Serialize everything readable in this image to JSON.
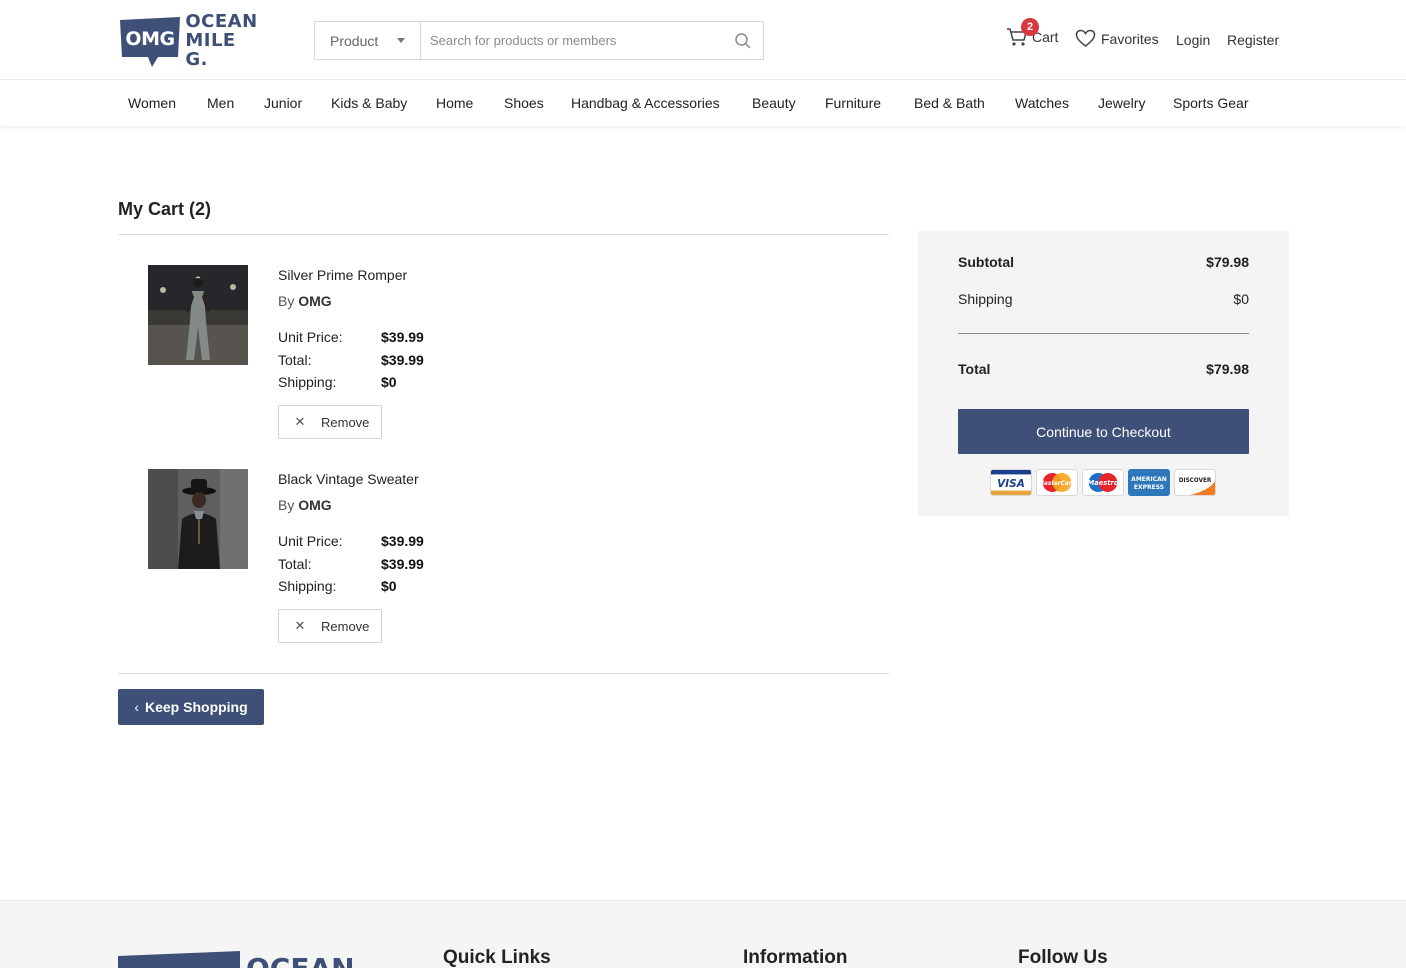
{
  "brand": {
    "badge": "OMG",
    "line1": "OCEAN",
    "line2": "MILE G."
  },
  "search": {
    "category": "Product",
    "placeholder": "Search for products or members"
  },
  "header": {
    "cart_count": "2",
    "cart_label": "Cart",
    "favorites_label": "Favorites",
    "login_label": "Login",
    "register_label": "Register"
  },
  "nav": [
    "Women",
    "Men",
    "Junior",
    "Kids & Baby",
    "Home",
    "Shoes",
    "Handbag & Accessories",
    "Beauty",
    "Furniture",
    "Bed & Bath",
    "Watches",
    "Jewelry",
    "Sports Gear"
  ],
  "cart": {
    "title": "My Cart (2)",
    "items": [
      {
        "name": "Silver Prime Romper",
        "by": "By",
        "brand": "OMG",
        "unit_price_label": "Unit Price:",
        "unit_price": "$39.99",
        "total_label": "Total:",
        "total": "$39.99",
        "shipping_label": "Shipping:",
        "shipping": "$0",
        "remove_label": "Remove"
      },
      {
        "name": "Black Vintage Sweater",
        "by": "By",
        "brand": "OMG",
        "unit_price_label": "Unit Price:",
        "unit_price": "$39.99",
        "total_label": "Total:",
        "total": "$39.99",
        "shipping_label": "Shipping:",
        "shipping": "$0",
        "remove_label": "Remove"
      }
    ],
    "keep_shopping_label": "Keep Shopping"
  },
  "summary": {
    "subtotal_label": "Subtotal",
    "subtotal": "$79.98",
    "shipping_label": "Shipping",
    "shipping": "$0",
    "total_label": "Total",
    "total": "$79.98",
    "checkout_label": "Continue to Checkout",
    "cards": {
      "visa": "VISA",
      "mastercard": "MasterCard",
      "maestro": "Maestro",
      "amex_1": "AMERICAN",
      "amex_2": "EXPRESS",
      "discover": "DISCOVER"
    }
  },
  "footer": {
    "logo_text": "OCEAN",
    "quick_links": "Quick Links",
    "information": "Information",
    "follow_us": "Follow Us"
  },
  "colors": {
    "brand": "#3e5078",
    "badge": "#d9363e",
    "summary_bg": "#f4f4f5"
  }
}
